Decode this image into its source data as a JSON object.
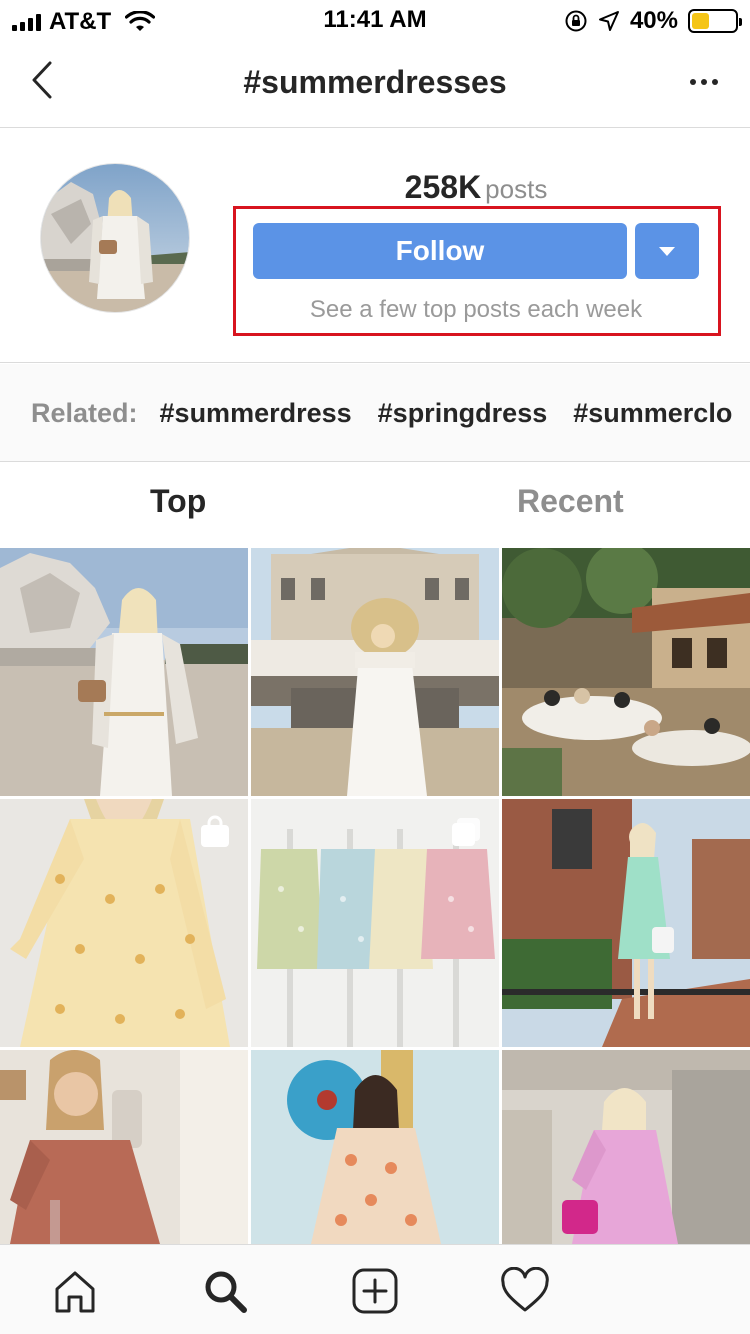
{
  "status_bar": {
    "carrier": "AT&T",
    "time": "11:41 AM",
    "battery_percent": "40%",
    "battery_level": 0.4,
    "battery_color": "#f5c518"
  },
  "nav": {
    "title": "#summerdresses",
    "back_icon": "chevron-left-icon",
    "more_icon": "more-horizontal-icon"
  },
  "hashtag": {
    "post_count": "258K",
    "post_label": "posts",
    "follow_label": "Follow",
    "follow_color": "#5b93e6",
    "follow_subtitle": "See a few top posts each week",
    "highlight_color": "#d8141f"
  },
  "related": {
    "label": "Related:",
    "tags": [
      "#summerdress",
      "#springdress",
      "#summerclo"
    ]
  },
  "tabs": [
    {
      "label": "Top",
      "active": true
    },
    {
      "label": "Recent",
      "active": false
    }
  ],
  "grid": {
    "posts": [
      {
        "name": "white-dress-statue",
        "badge": ""
      },
      {
        "name": "white-dress-sunhat-mansion",
        "badge": ""
      },
      {
        "name": "outdoor-dinner-terrace",
        "badge": ""
      },
      {
        "name": "yellow-floral-dress",
        "badge": "shopping-bag-icon"
      },
      {
        "name": "four-dresses-mannequins",
        "badge": "carousel-icon"
      },
      {
        "name": "mint-dress-brick-street",
        "badge": ""
      },
      {
        "name": "red-dress-mirror-selfie",
        "badge": ""
      },
      {
        "name": "floral-dress-blue-record",
        "badge": ""
      },
      {
        "name": "pink-dress-storefront",
        "badge": ""
      }
    ]
  },
  "tabbar": {
    "items": [
      "home-icon",
      "search-icon",
      "new-post-icon",
      "activity-heart-icon"
    ]
  }
}
